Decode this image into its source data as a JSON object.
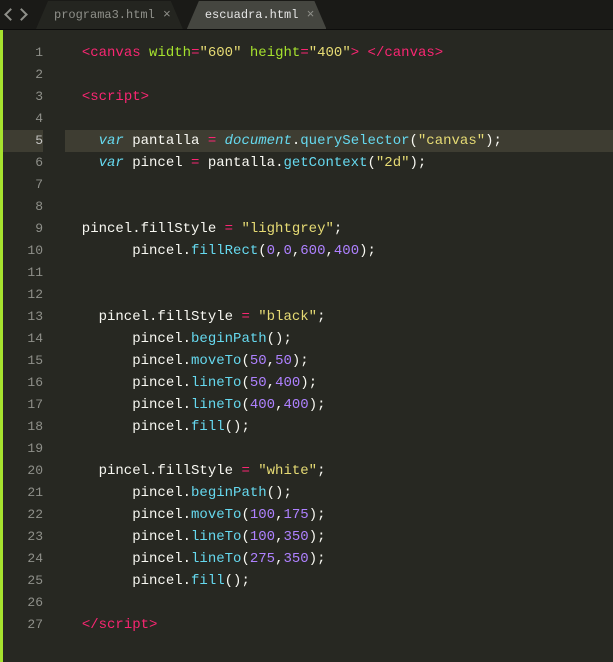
{
  "tabs": [
    {
      "label": "programa3.html",
      "active": false
    },
    {
      "label": "escuadra.html",
      "active": true
    }
  ],
  "highlighted_line": 5,
  "code_lines": [
    {
      "n": 1,
      "tokens": [
        [
          "c-white",
          "  "
        ],
        [
          "c-red",
          "<"
        ],
        [
          "c-red",
          "canvas"
        ],
        [
          "c-white",
          " "
        ],
        [
          "c-green",
          "width"
        ],
        [
          "c-red",
          "="
        ],
        [
          "c-yellow",
          "\"600\""
        ],
        [
          "c-white",
          " "
        ],
        [
          "c-green",
          "height"
        ],
        [
          "c-red",
          "="
        ],
        [
          "c-yellow",
          "\"400\""
        ],
        [
          "c-red",
          ">"
        ],
        [
          "c-white",
          " "
        ],
        [
          "c-red",
          "</"
        ],
        [
          "c-red",
          "canvas"
        ],
        [
          "c-red",
          ">"
        ]
      ]
    },
    {
      "n": 2,
      "tokens": []
    },
    {
      "n": 3,
      "tokens": [
        [
          "c-white",
          "  "
        ],
        [
          "c-red",
          "<"
        ],
        [
          "c-red",
          "script"
        ],
        [
          "c-red",
          ">"
        ]
      ]
    },
    {
      "n": 4,
      "tokens": []
    },
    {
      "n": 5,
      "tokens": [
        [
          "c-white",
          "    "
        ],
        [
          "c-blue",
          "var"
        ],
        [
          "c-white",
          " pantalla "
        ],
        [
          "c-red",
          "="
        ],
        [
          "c-white",
          " "
        ],
        [
          "c-blue italic",
          "document"
        ],
        [
          "c-white",
          "."
        ],
        [
          "c-blue-n",
          "querySelector"
        ],
        [
          "c-white",
          "("
        ],
        [
          "c-yellow",
          "\"canvas\""
        ],
        [
          "c-white",
          ");"
        ]
      ]
    },
    {
      "n": 6,
      "tokens": [
        [
          "c-white",
          "    "
        ],
        [
          "c-blue",
          "var"
        ],
        [
          "c-white",
          " pincel "
        ],
        [
          "c-red",
          "="
        ],
        [
          "c-white",
          " pantalla."
        ],
        [
          "c-blue-n",
          "getContext"
        ],
        [
          "c-white",
          "("
        ],
        [
          "c-yellow",
          "\"2d\""
        ],
        [
          "c-white",
          ");"
        ]
      ]
    },
    {
      "n": 7,
      "tokens": []
    },
    {
      "n": 8,
      "tokens": []
    },
    {
      "n": 9,
      "tokens": [
        [
          "c-white",
          "  pincel.fillStyle "
        ],
        [
          "c-red",
          "="
        ],
        [
          "c-white",
          " "
        ],
        [
          "c-yellow",
          "\"lightgrey\""
        ],
        [
          "c-white",
          ";"
        ]
      ]
    },
    {
      "n": 10,
      "tokens": [
        [
          "c-white",
          "        pincel."
        ],
        [
          "c-blue-n",
          "fillRect"
        ],
        [
          "c-white",
          "("
        ],
        [
          "c-purple",
          "0"
        ],
        [
          "c-white",
          ","
        ],
        [
          "c-purple",
          "0"
        ],
        [
          "c-white",
          ","
        ],
        [
          "c-purple",
          "600"
        ],
        [
          "c-white",
          ","
        ],
        [
          "c-purple",
          "400"
        ],
        [
          "c-white",
          ");"
        ]
      ]
    },
    {
      "n": 11,
      "tokens": []
    },
    {
      "n": 12,
      "tokens": []
    },
    {
      "n": 13,
      "tokens": [
        [
          "c-white",
          "    pincel.fillStyle "
        ],
        [
          "c-red",
          "="
        ],
        [
          "c-white",
          " "
        ],
        [
          "c-yellow",
          "\"black\""
        ],
        [
          "c-white",
          ";"
        ]
      ]
    },
    {
      "n": 14,
      "tokens": [
        [
          "c-white",
          "        pincel."
        ],
        [
          "c-blue-n",
          "beginPath"
        ],
        [
          "c-white",
          "();"
        ]
      ]
    },
    {
      "n": 15,
      "tokens": [
        [
          "c-white",
          "        pincel."
        ],
        [
          "c-blue-n",
          "moveTo"
        ],
        [
          "c-white",
          "("
        ],
        [
          "c-purple",
          "50"
        ],
        [
          "c-white",
          ","
        ],
        [
          "c-purple",
          "50"
        ],
        [
          "c-white",
          ");"
        ]
      ]
    },
    {
      "n": 16,
      "tokens": [
        [
          "c-white",
          "        pincel."
        ],
        [
          "c-blue-n",
          "lineTo"
        ],
        [
          "c-white",
          "("
        ],
        [
          "c-purple",
          "50"
        ],
        [
          "c-white",
          ","
        ],
        [
          "c-purple",
          "400"
        ],
        [
          "c-white",
          ");"
        ]
      ]
    },
    {
      "n": 17,
      "tokens": [
        [
          "c-white",
          "        pincel."
        ],
        [
          "c-blue-n",
          "lineTo"
        ],
        [
          "c-white",
          "("
        ],
        [
          "c-purple",
          "400"
        ],
        [
          "c-white",
          ","
        ],
        [
          "c-purple",
          "400"
        ],
        [
          "c-white",
          ");"
        ]
      ]
    },
    {
      "n": 18,
      "tokens": [
        [
          "c-white",
          "        pincel."
        ],
        [
          "c-blue-n",
          "fill"
        ],
        [
          "c-white",
          "();"
        ]
      ]
    },
    {
      "n": 19,
      "tokens": []
    },
    {
      "n": 20,
      "tokens": [
        [
          "c-white",
          "    pincel.fillStyle "
        ],
        [
          "c-red",
          "="
        ],
        [
          "c-white",
          " "
        ],
        [
          "c-yellow",
          "\"white\""
        ],
        [
          "c-white",
          ";"
        ]
      ]
    },
    {
      "n": 21,
      "tokens": [
        [
          "c-white",
          "        pincel."
        ],
        [
          "c-blue-n",
          "beginPath"
        ],
        [
          "c-white",
          "();"
        ]
      ]
    },
    {
      "n": 22,
      "tokens": [
        [
          "c-white",
          "        pincel."
        ],
        [
          "c-blue-n",
          "moveTo"
        ],
        [
          "c-white",
          "("
        ],
        [
          "c-purple",
          "100"
        ],
        [
          "c-white",
          ","
        ],
        [
          "c-purple",
          "175"
        ],
        [
          "c-white",
          ");"
        ]
      ]
    },
    {
      "n": 23,
      "tokens": [
        [
          "c-white",
          "        pincel."
        ],
        [
          "c-blue-n",
          "lineTo"
        ],
        [
          "c-white",
          "("
        ],
        [
          "c-purple",
          "100"
        ],
        [
          "c-white",
          ","
        ],
        [
          "c-purple",
          "350"
        ],
        [
          "c-white",
          ");"
        ]
      ]
    },
    {
      "n": 24,
      "tokens": [
        [
          "c-white",
          "        pincel."
        ],
        [
          "c-blue-n",
          "lineTo"
        ],
        [
          "c-white",
          "("
        ],
        [
          "c-purple",
          "275"
        ],
        [
          "c-white",
          ","
        ],
        [
          "c-purple",
          "350"
        ],
        [
          "c-white",
          ");"
        ]
      ]
    },
    {
      "n": 25,
      "tokens": [
        [
          "c-white",
          "        pincel."
        ],
        [
          "c-blue-n",
          "fill"
        ],
        [
          "c-white",
          "();"
        ]
      ]
    },
    {
      "n": 26,
      "tokens": []
    },
    {
      "n": 27,
      "tokens": [
        [
          "c-white",
          "  "
        ],
        [
          "c-red",
          "</"
        ],
        [
          "c-red",
          "script"
        ],
        [
          "c-red",
          ">"
        ]
      ]
    }
  ]
}
